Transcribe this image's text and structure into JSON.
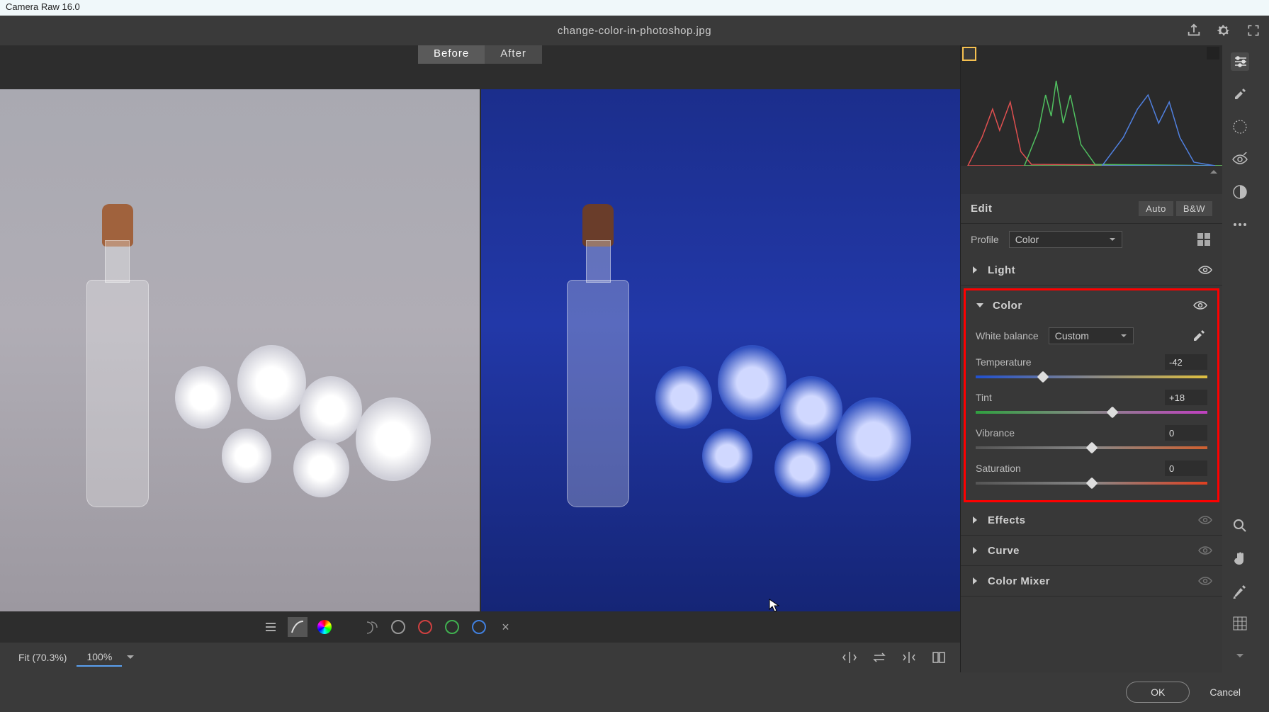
{
  "window_title": "Camera Raw 16.0",
  "filename": "change-color-in-photoshop.jpg",
  "tabs": {
    "before": "Before",
    "after": "After"
  },
  "zoom": {
    "fit": "Fit (70.3%)",
    "hundred": "100%"
  },
  "edit": {
    "label": "Edit",
    "auto": "Auto",
    "bw": "B&W"
  },
  "profile": {
    "label": "Profile",
    "value": "Color"
  },
  "sections": {
    "light": "Light",
    "color": "Color",
    "effects": "Effects",
    "curve": "Curve",
    "mixer": "Color Mixer"
  },
  "color_panel": {
    "wb_label": "White balance",
    "wb_value": "Custom",
    "temperature": {
      "label": "Temperature",
      "value": "-42",
      "pos": 29
    },
    "tint": {
      "label": "Tint",
      "value": "+18",
      "pos": 59
    },
    "vibrance": {
      "label": "Vibrance",
      "value": "0",
      "pos": 50
    },
    "saturation": {
      "label": "Saturation",
      "value": "0",
      "pos": 50
    }
  },
  "buttons": {
    "ok": "OK",
    "cancel": "Cancel"
  }
}
